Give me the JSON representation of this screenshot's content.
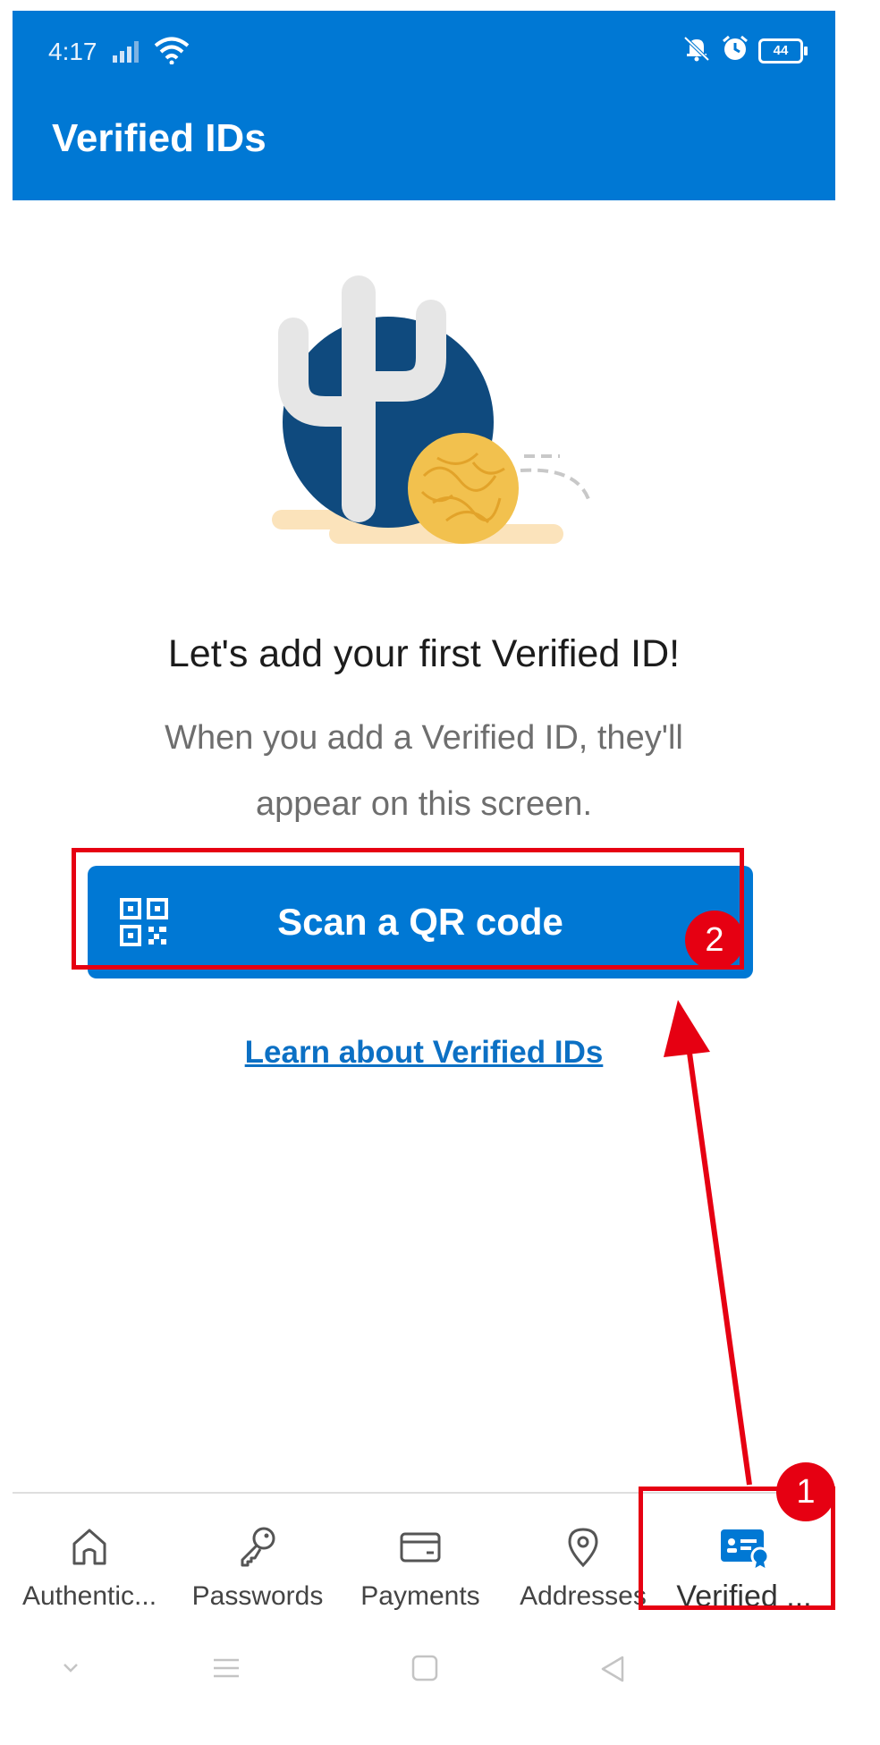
{
  "status_bar": {
    "time": "4:17",
    "battery": "44"
  },
  "header": {
    "title": "Verified IDs"
  },
  "empty_state": {
    "headline": "Let's add your first Verified ID!",
    "subtext_line1": "When you add a Verified ID, they'll",
    "subtext_line2": "appear on this screen."
  },
  "actions": {
    "scan_label": "Scan a QR code",
    "learn_link": "Learn about Verified IDs"
  },
  "bottom_nav": {
    "items": [
      {
        "label": "Authentic...",
        "icon": "home-icon"
      },
      {
        "label": "Passwords",
        "icon": "key-icon"
      },
      {
        "label": "Payments",
        "icon": "card-icon"
      },
      {
        "label": "Addresses",
        "icon": "location-icon"
      },
      {
        "label": "Verified ...",
        "icon": "verified-id-icon",
        "active": true
      }
    ]
  },
  "annotations": {
    "step1": "1",
    "step2": "2"
  },
  "colors": {
    "accent": "#0078d4",
    "annotation": "#e60012"
  }
}
